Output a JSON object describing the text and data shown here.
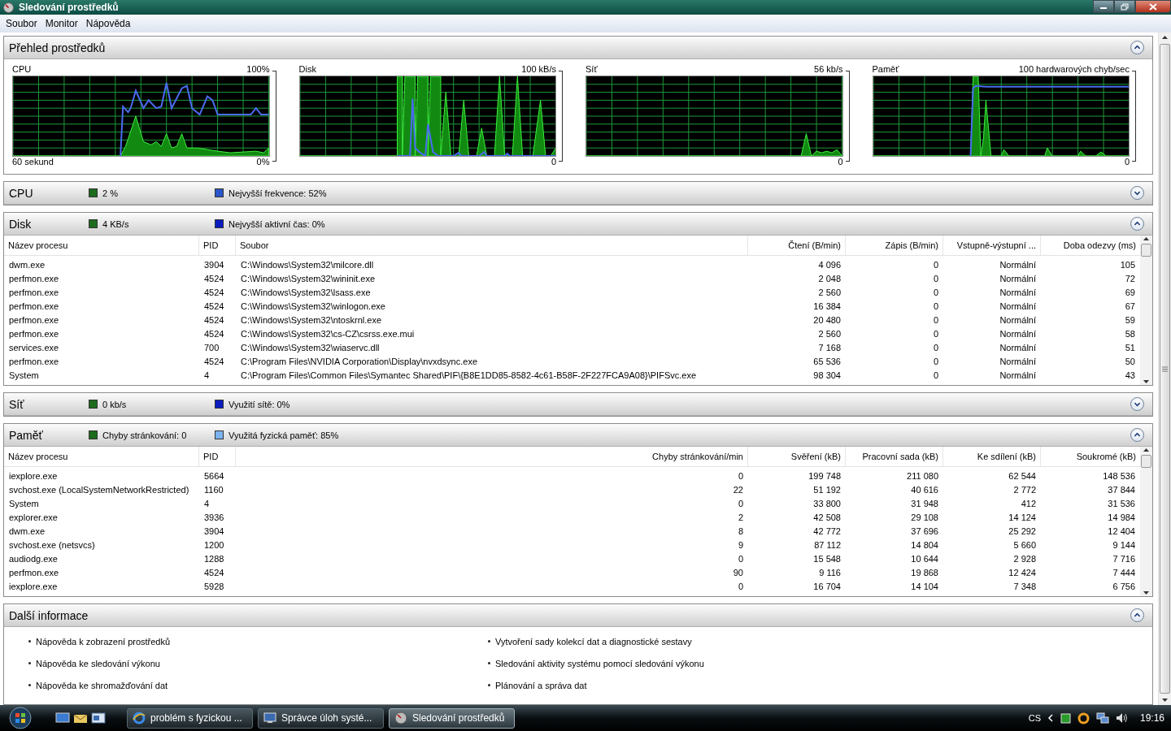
{
  "window": {
    "title": "Sledování prostředků"
  },
  "menu": [
    "Soubor",
    "Monitor",
    "Nápověda"
  ],
  "sections": [
    {
      "kind": "graphs",
      "title": "Přehled prostředků",
      "expanded": true,
      "graphs": [
        {
          "title": "CPU",
          "max": "100%",
          "min": "0%",
          "time_span": "60 sekund"
        },
        {
          "title": "Disk",
          "max": "100 kB/s",
          "min": "0"
        },
        {
          "title": "Síť",
          "max": "56 kb/s",
          "min": "0"
        },
        {
          "title": "Paměť",
          "max": "100 hardwarových chyb/sec",
          "min": "0"
        }
      ]
    },
    {
      "kind": "legend",
      "title": "CPU",
      "expanded": false,
      "legend": [
        {
          "label": "2 %",
          "color": "#1d6b1d"
        },
        {
          "label": "Nejvyšší frekvence: 52%",
          "color": "#2a55c8"
        }
      ]
    },
    {
      "kind": "table",
      "title": "Disk",
      "expanded": true,
      "legend": [
        {
          "label": "4 KB/s",
          "color": "#1d6b1d"
        },
        {
          "label": "Nejvyšší aktivní čas: 0%",
          "color": "#0a1cc0"
        }
      ],
      "table": {
        "columns": [
          "Název procesu",
          "PID",
          "Soubor",
          "Čtení (B/min)",
          "Zápis (B/min)",
          "Vstupně-výstupní ...",
          "Doba odezvy (ms)"
        ],
        "rows": [
          [
            "dwm.exe",
            "3904",
            "C:\\Windows\\System32\\milcore.dll",
            "4 096",
            "0",
            "Normální",
            "105"
          ],
          [
            "perfmon.exe",
            "4524",
            "C:\\Windows\\System32\\wininit.exe",
            "2 048",
            "0",
            "Normální",
            "72"
          ],
          [
            "perfmon.exe",
            "4524",
            "C:\\Windows\\System32\\lsass.exe",
            "2 560",
            "0",
            "Normální",
            "69"
          ],
          [
            "perfmon.exe",
            "4524",
            "C:\\Windows\\System32\\winlogon.exe",
            "16 384",
            "0",
            "Normální",
            "67"
          ],
          [
            "perfmon.exe",
            "4524",
            "C:\\Windows\\System32\\ntoskrnl.exe",
            "20 480",
            "0",
            "Normální",
            "59"
          ],
          [
            "perfmon.exe",
            "4524",
            "C:\\Windows\\System32\\cs-CZ\\csrss.exe.mui",
            "2 560",
            "0",
            "Normální",
            "58"
          ],
          [
            "services.exe",
            "700",
            "C:\\Windows\\System32\\wiaservc.dll",
            "7 168",
            "0",
            "Normální",
            "51"
          ],
          [
            "perfmon.exe",
            "4524",
            "C:\\Program Files\\NVIDIA Corporation\\Display\\nvxdsync.exe",
            "65 536",
            "0",
            "Normální",
            "50"
          ],
          [
            "System",
            "4",
            "C:\\Program Files\\Common Files\\Symantec Shared\\PIF\\{B8E1DD85-8582-4c61-B58F-2F227FCA9A08}\\PIFSvc.exe",
            "98 304",
            "0",
            "Normální",
            "43"
          ]
        ]
      }
    },
    {
      "kind": "legend",
      "title": "Síť",
      "expanded": false,
      "legend": [
        {
          "label": "0 kb/s",
          "color": "#1d6b1d"
        },
        {
          "label": "Využití sítě: 0%",
          "color": "#0a1cc0"
        }
      ]
    },
    {
      "kind": "table",
      "title": "Paměť",
      "expanded": true,
      "legend": [
        {
          "label": "Chyby stránkování: 0",
          "color": "#1d6b1d"
        },
        {
          "label": "Využitá fyzická paměť: 85%",
          "color": "#7ab4ee"
        }
      ],
      "table": {
        "columns": [
          "Název procesu",
          "PID",
          "Chyby stránkování/min",
          "Svěření (kB)",
          "Pracovní sada (kB)",
          "Ke sdílení (kB)",
          "Soukromé (kB)"
        ],
        "rows": [
          [
            "iexplore.exe",
            "5664",
            "0",
            "199 748",
            "211 080",
            "62 544",
            "148 536"
          ],
          [
            "svchost.exe (LocalSystemNetworkRestricted)",
            "1160",
            "22",
            "51 192",
            "40 616",
            "2 772",
            "37 844"
          ],
          [
            "System",
            "4",
            "0",
            "33 800",
            "31 948",
            "412",
            "31 536"
          ],
          [
            "explorer.exe",
            "3936",
            "2",
            "42 508",
            "29 108",
            "14 124",
            "14 984"
          ],
          [
            "dwm.exe",
            "3904",
            "8",
            "42 772",
            "37 696",
            "25 292",
            "12 404"
          ],
          [
            "svchost.exe (netsvcs)",
            "1200",
            "9",
            "87 112",
            "14 804",
            "5 660",
            "9 144"
          ],
          [
            "audiodg.exe",
            "1288",
            "0",
            "15 548",
            "10 644",
            "2 928",
            "7 716"
          ],
          [
            "perfmon.exe",
            "4524",
            "90",
            "9 116",
            "19 868",
            "12 424",
            "7 444"
          ],
          [
            "iexplore.exe",
            "5928",
            "0",
            "16 704",
            "14 104",
            "7 348",
            "6 756"
          ]
        ]
      }
    },
    {
      "kind": "links",
      "title": "Další informace",
      "expanded": true,
      "links": [
        "Nápověda k zobrazení prostředků",
        "Vytvoření sady kolekcí dat a diagnostické sestavy",
        "Nápověda ke sledování výkonu",
        "Sledování aktivity systému pomocí sledování výkonu",
        "Nápověda ke shromažďování dat",
        "Plánování a správa dat"
      ]
    }
  ],
  "taskbar": {
    "tasks": [
      {
        "label": "problém s fyzickou ...",
        "selected": false
      },
      {
        "label": "Správce úloh systé...",
        "selected": false
      },
      {
        "label": "Sledování prostředků",
        "selected": true
      }
    ],
    "language": "CS",
    "clock": "19:16"
  }
}
